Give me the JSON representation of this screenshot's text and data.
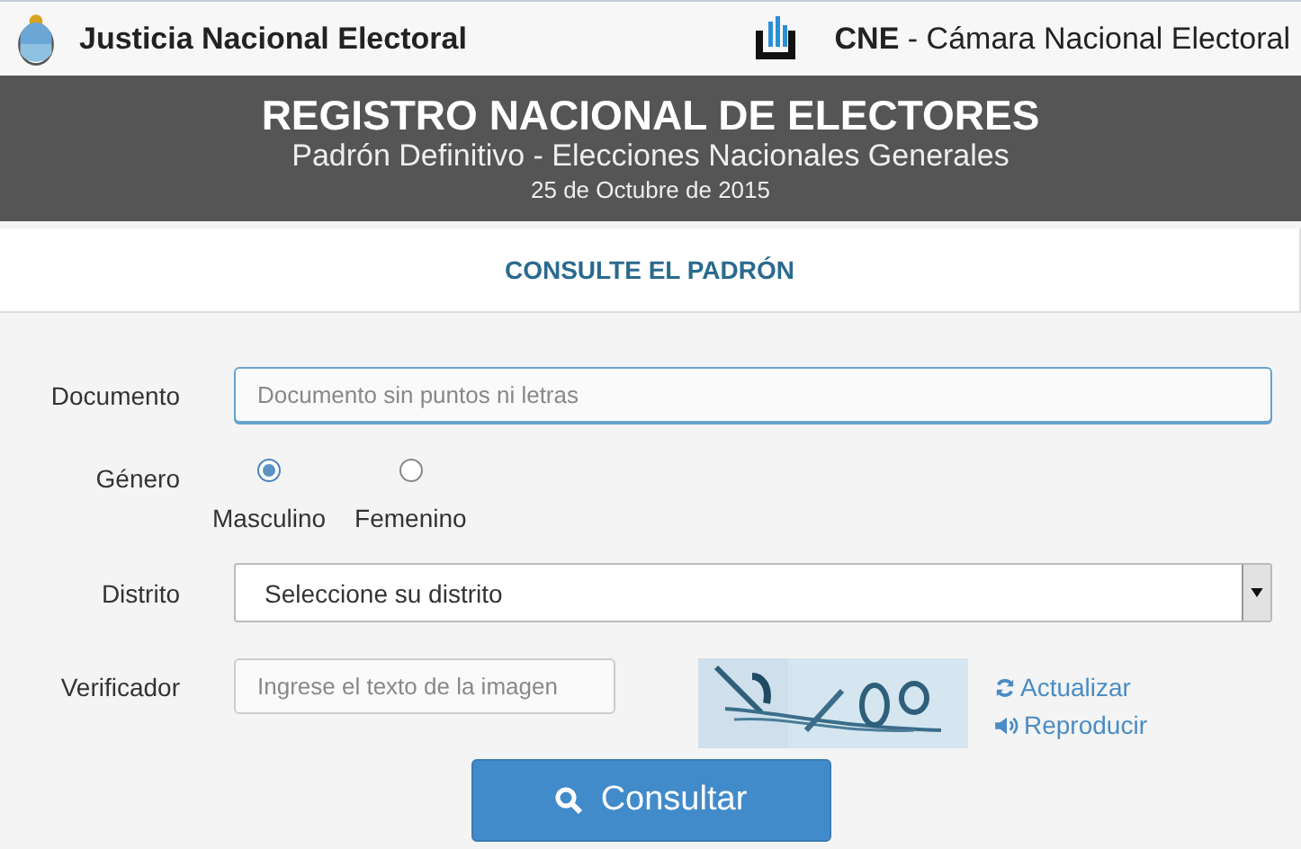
{
  "header": {
    "left_title": "Justicia Nacional Electoral",
    "right_abbr": "CNE",
    "right_title": " - Cámara Nacional Electoral"
  },
  "banner": {
    "title": "REGISTRO NACIONAL DE ELECTORES",
    "subtitle": "Padrón Definitivo - Elecciones Nacionales Generales",
    "date": "25 de Octubre de 2015"
  },
  "section_title": "CONSULTE EL PADRÓN",
  "form": {
    "documento": {
      "label": "Documento",
      "placeholder": "Documento sin puntos ni letras"
    },
    "genero": {
      "label": "Género",
      "options": [
        {
          "label": "Masculino",
          "selected": true
        },
        {
          "label": "Femenino",
          "selected": false
        }
      ]
    },
    "distrito": {
      "label": "Distrito",
      "value": "Seleccione su distrito"
    },
    "verificador": {
      "label": "Verificador",
      "placeholder": "Ingrese el texto de la imagen",
      "links": [
        {
          "kind": "refresh",
          "label": "Actualizar"
        },
        {
          "kind": "audio",
          "label": "Reproducir"
        }
      ]
    },
    "submit": "Consultar"
  }
}
